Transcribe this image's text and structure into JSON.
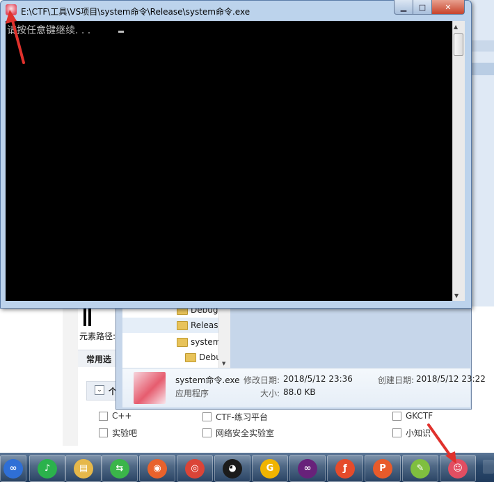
{
  "console": {
    "title": "E:\\CTF\\工具\\VS项目\\system命令\\Release\\system命令.exe",
    "output": "请按任意键继续. . .",
    "controls": {
      "minimize": "▁",
      "maximize": "□",
      "close": "✕"
    }
  },
  "background_page": {
    "breadcrumb": "元素路径:",
    "section": "常用选",
    "subsection": "个",
    "checkboxes": [
      [
        "C++",
        "CTF-练习平台",
        "GKCTF"
      ],
      [
        "实验吧",
        "网络安全实验室",
        "小知识"
      ]
    ]
  },
  "explorer": {
    "tree": [
      "Debug",
      "Releas",
      "system",
      "Debu"
    ],
    "details": {
      "file_name": "system命令.exe",
      "file_type": "应用程序",
      "modified_label": "修改日期:",
      "modified_value": "2018/5/12 23:36",
      "created_label": "创建日期:",
      "created_value": "2018/5/12 23:22",
      "size_label": "大小:",
      "size_value": "88.0 KB"
    }
  },
  "taskbar": {
    "apps": [
      {
        "icon": "baidu-netdisk-icon",
        "color": "#2f6fd6",
        "glyph": "∞"
      },
      {
        "icon": "music-app-icon",
        "color": "#2bb24c",
        "glyph": "♪"
      },
      {
        "icon": "file-explorer-icon",
        "color": "#e6b84a",
        "glyph": "▤"
      },
      {
        "icon": "iqiyi-icon",
        "color": "#3bb54a",
        "glyph": "⇆"
      },
      {
        "icon": "firefox-icon",
        "color": "#e8622c",
        "glyph": "◉"
      },
      {
        "icon": "chrome-icon",
        "color": "#db4437",
        "glyph": "◎"
      },
      {
        "icon": "qq-icon",
        "color": "#1b1b1b",
        "glyph": "◕"
      },
      {
        "icon": "gitlab-icon",
        "color": "#f0b400",
        "glyph": "G"
      },
      {
        "icon": "visual-studio-icon",
        "color": "#68217a",
        "glyph": "∞"
      },
      {
        "icon": "flash-icon",
        "color": "#e54b2b",
        "glyph": "ƒ"
      },
      {
        "icon": "wps-presentation-icon",
        "color": "#e85b2b",
        "glyph": "P"
      },
      {
        "icon": "notepad-plus-icon",
        "color": "#7fbf3f",
        "glyph": "✎"
      },
      {
        "icon": "console-app-icon",
        "color": "#e24e62",
        "glyph": "☺"
      }
    ]
  },
  "colors": {
    "console_bg": "#000000",
    "console_text": "#c0c0c0",
    "arrow": "#e0312c",
    "taskbar": "#2c4a6d"
  }
}
